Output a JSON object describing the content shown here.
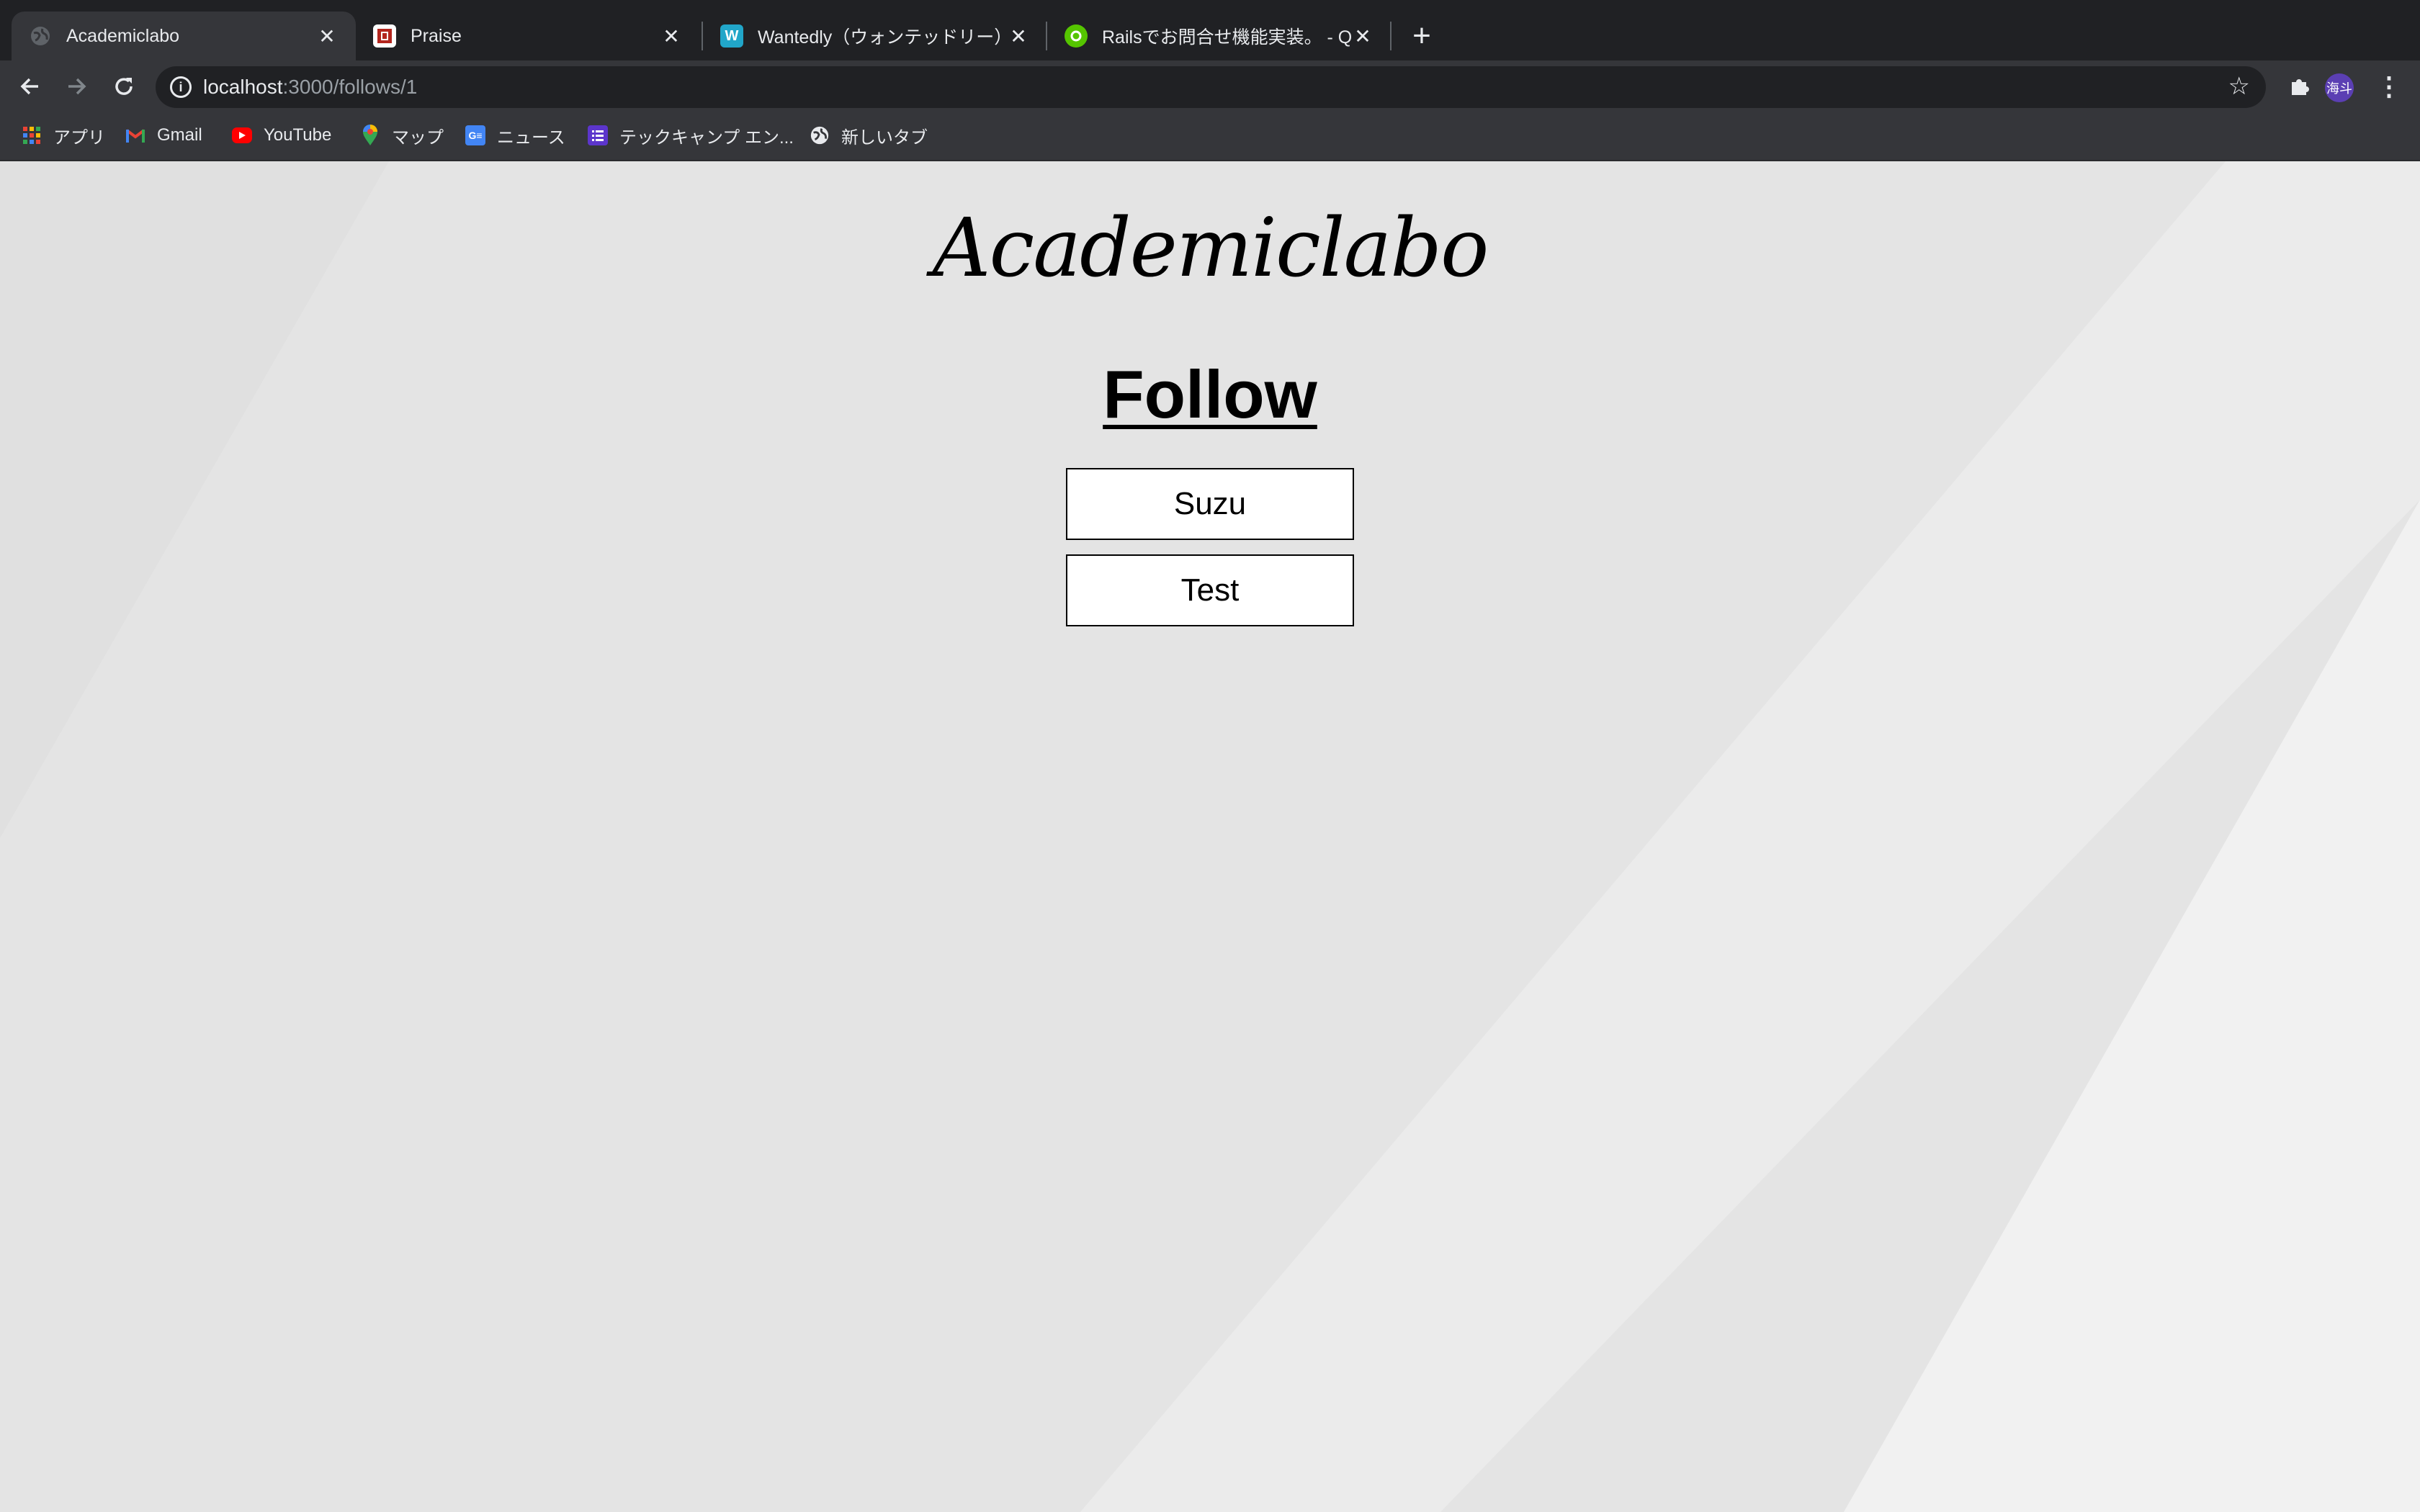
{
  "browser": {
    "tabs": [
      {
        "title": "Academiclabo",
        "icon": "globe-icon",
        "active": true
      },
      {
        "title": "Praise",
        "icon": "praise-favicon",
        "active": false
      },
      {
        "title": "Wantedly（ウォンテッドリー）は",
        "icon": "wantedly-favicon",
        "active": false
      },
      {
        "title": "Railsでお問合せ機能実装。 - Qiita",
        "icon": "qiita-favicon",
        "active": false
      }
    ],
    "address": {
      "host": "localhost",
      "rest": ":3000/follows/1"
    },
    "bookmarks": [
      {
        "label": "アプリ",
        "icon": "apps-grid-icon"
      },
      {
        "label": "Gmail",
        "icon": "gmail-icon"
      },
      {
        "label": "YouTube",
        "icon": "youtube-icon"
      },
      {
        "label": "マップ",
        "icon": "maps-pin-icon"
      },
      {
        "label": "ニュース",
        "icon": "news-icon"
      },
      {
        "label": "テックキャンプ エン...",
        "icon": "list-icon"
      },
      {
        "label": "新しいタブ",
        "icon": "globe-icon"
      }
    ],
    "profile_initials": "海斗",
    "colors": {
      "chrome_dark": "#202124",
      "chrome_toolbar": "#35363a",
      "avatar": "#5b3fb3"
    }
  },
  "page": {
    "brand": "Academiclabo",
    "heading": "Follow",
    "follows": [
      "Suzu",
      "Test"
    ],
    "colors": {
      "background": "#e4e4e4",
      "stripe": "#efefef",
      "box": "#ffffff",
      "text": "#000000"
    }
  }
}
